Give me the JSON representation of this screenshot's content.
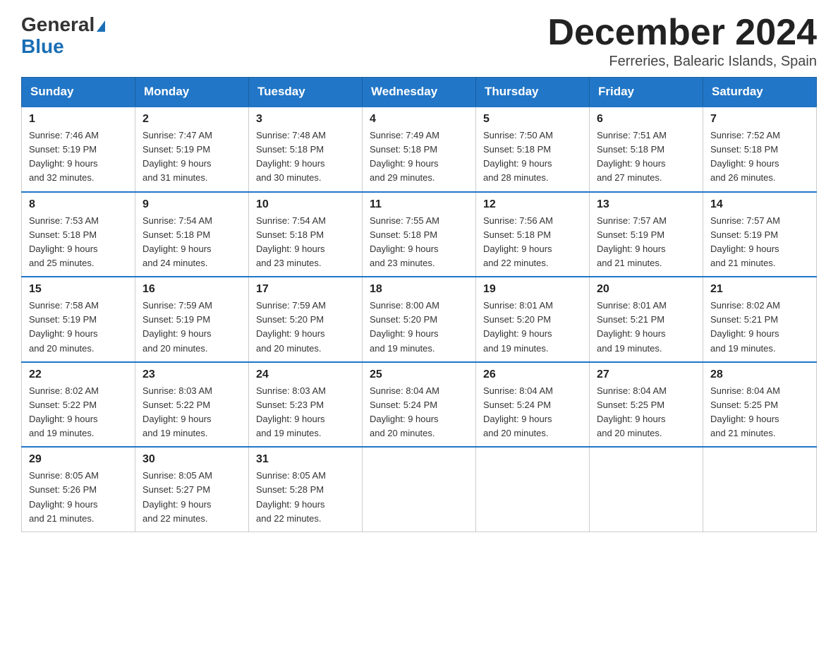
{
  "header": {
    "logo_general": "General",
    "logo_blue": "Blue",
    "month_title": "December 2024",
    "location": "Ferreries, Balearic Islands, Spain"
  },
  "days_of_week": [
    "Sunday",
    "Monday",
    "Tuesday",
    "Wednesday",
    "Thursday",
    "Friday",
    "Saturday"
  ],
  "weeks": [
    [
      {
        "day": "1",
        "sunrise": "7:46 AM",
        "sunset": "5:19 PM",
        "daylight": "9 hours and 32 minutes."
      },
      {
        "day": "2",
        "sunrise": "7:47 AM",
        "sunset": "5:19 PM",
        "daylight": "9 hours and 31 minutes."
      },
      {
        "day": "3",
        "sunrise": "7:48 AM",
        "sunset": "5:18 PM",
        "daylight": "9 hours and 30 minutes."
      },
      {
        "day": "4",
        "sunrise": "7:49 AM",
        "sunset": "5:18 PM",
        "daylight": "9 hours and 29 minutes."
      },
      {
        "day": "5",
        "sunrise": "7:50 AM",
        "sunset": "5:18 PM",
        "daylight": "9 hours and 28 minutes."
      },
      {
        "day": "6",
        "sunrise": "7:51 AM",
        "sunset": "5:18 PM",
        "daylight": "9 hours and 27 minutes."
      },
      {
        "day": "7",
        "sunrise": "7:52 AM",
        "sunset": "5:18 PM",
        "daylight": "9 hours and 26 minutes."
      }
    ],
    [
      {
        "day": "8",
        "sunrise": "7:53 AM",
        "sunset": "5:18 PM",
        "daylight": "9 hours and 25 minutes."
      },
      {
        "day": "9",
        "sunrise": "7:54 AM",
        "sunset": "5:18 PM",
        "daylight": "9 hours and 24 minutes."
      },
      {
        "day": "10",
        "sunrise": "7:54 AM",
        "sunset": "5:18 PM",
        "daylight": "9 hours and 23 minutes."
      },
      {
        "day": "11",
        "sunrise": "7:55 AM",
        "sunset": "5:18 PM",
        "daylight": "9 hours and 23 minutes."
      },
      {
        "day": "12",
        "sunrise": "7:56 AM",
        "sunset": "5:18 PM",
        "daylight": "9 hours and 22 minutes."
      },
      {
        "day": "13",
        "sunrise": "7:57 AM",
        "sunset": "5:19 PM",
        "daylight": "9 hours and 21 minutes."
      },
      {
        "day": "14",
        "sunrise": "7:57 AM",
        "sunset": "5:19 PM",
        "daylight": "9 hours and 21 minutes."
      }
    ],
    [
      {
        "day": "15",
        "sunrise": "7:58 AM",
        "sunset": "5:19 PM",
        "daylight": "9 hours and 20 minutes."
      },
      {
        "day": "16",
        "sunrise": "7:59 AM",
        "sunset": "5:19 PM",
        "daylight": "9 hours and 20 minutes."
      },
      {
        "day": "17",
        "sunrise": "7:59 AM",
        "sunset": "5:20 PM",
        "daylight": "9 hours and 20 minutes."
      },
      {
        "day": "18",
        "sunrise": "8:00 AM",
        "sunset": "5:20 PM",
        "daylight": "9 hours and 19 minutes."
      },
      {
        "day": "19",
        "sunrise": "8:01 AM",
        "sunset": "5:20 PM",
        "daylight": "9 hours and 19 minutes."
      },
      {
        "day": "20",
        "sunrise": "8:01 AM",
        "sunset": "5:21 PM",
        "daylight": "9 hours and 19 minutes."
      },
      {
        "day": "21",
        "sunrise": "8:02 AM",
        "sunset": "5:21 PM",
        "daylight": "9 hours and 19 minutes."
      }
    ],
    [
      {
        "day": "22",
        "sunrise": "8:02 AM",
        "sunset": "5:22 PM",
        "daylight": "9 hours and 19 minutes."
      },
      {
        "day": "23",
        "sunrise": "8:03 AM",
        "sunset": "5:22 PM",
        "daylight": "9 hours and 19 minutes."
      },
      {
        "day": "24",
        "sunrise": "8:03 AM",
        "sunset": "5:23 PM",
        "daylight": "9 hours and 19 minutes."
      },
      {
        "day": "25",
        "sunrise": "8:04 AM",
        "sunset": "5:24 PM",
        "daylight": "9 hours and 20 minutes."
      },
      {
        "day": "26",
        "sunrise": "8:04 AM",
        "sunset": "5:24 PM",
        "daylight": "9 hours and 20 minutes."
      },
      {
        "day": "27",
        "sunrise": "8:04 AM",
        "sunset": "5:25 PM",
        "daylight": "9 hours and 20 minutes."
      },
      {
        "day": "28",
        "sunrise": "8:04 AM",
        "sunset": "5:25 PM",
        "daylight": "9 hours and 21 minutes."
      }
    ],
    [
      {
        "day": "29",
        "sunrise": "8:05 AM",
        "sunset": "5:26 PM",
        "daylight": "9 hours and 21 minutes."
      },
      {
        "day": "30",
        "sunrise": "8:05 AM",
        "sunset": "5:27 PM",
        "daylight": "9 hours and 22 minutes."
      },
      {
        "day": "31",
        "sunrise": "8:05 AM",
        "sunset": "5:28 PM",
        "daylight": "9 hours and 22 minutes."
      },
      null,
      null,
      null,
      null
    ]
  ],
  "labels": {
    "sunrise_prefix": "Sunrise: ",
    "sunset_prefix": "Sunset: ",
    "daylight_prefix": "Daylight: "
  }
}
